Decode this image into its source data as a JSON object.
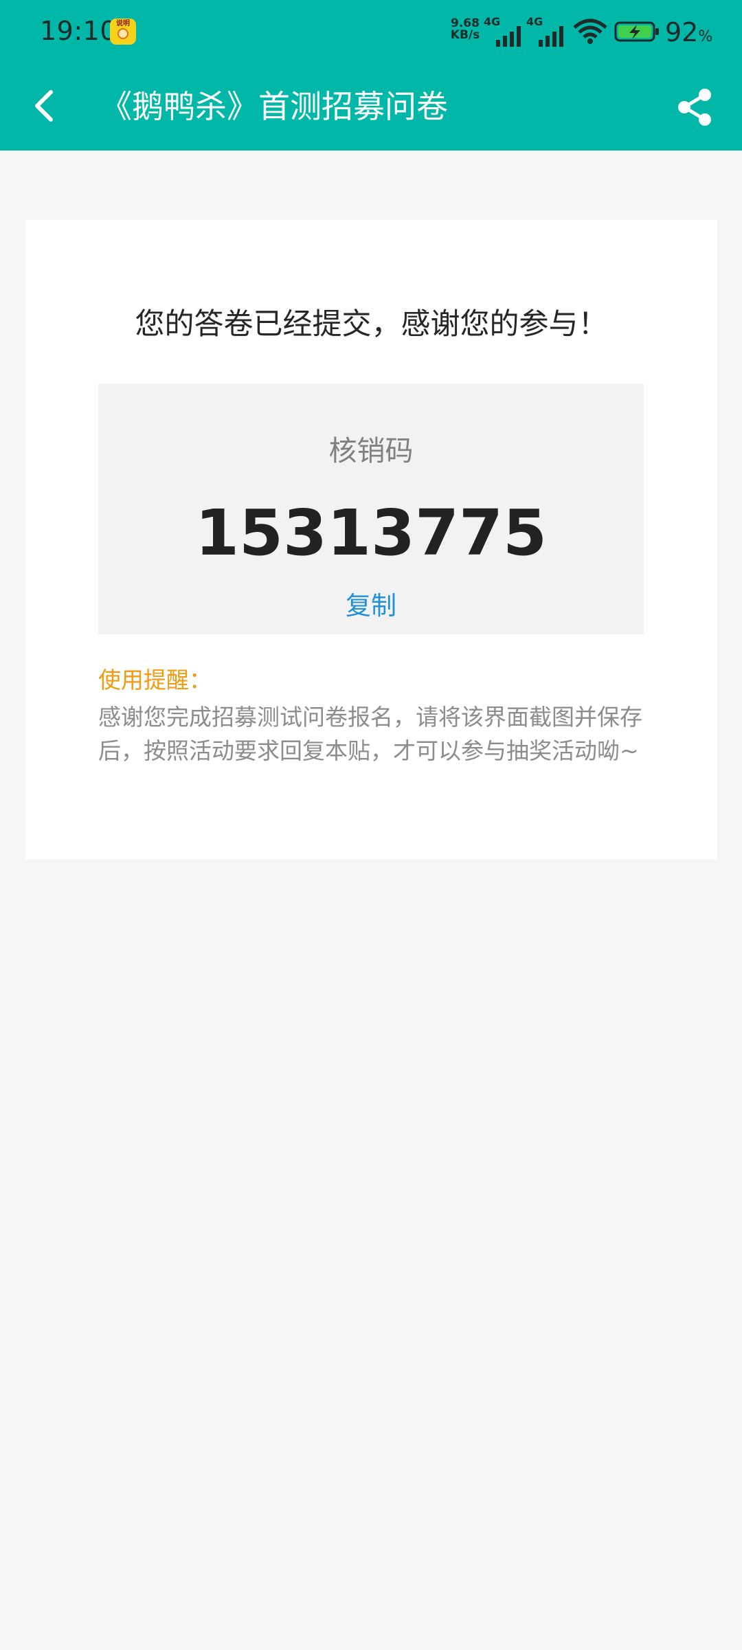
{
  "status_bar": {
    "time": "19:10",
    "app_badge_text": "说明",
    "net_speed_value": "9.68",
    "net_speed_unit": "KB/s",
    "network_type_1": "4G",
    "network_type_2": "4G",
    "battery_level": "92",
    "battery_unit": "%",
    "icons": [
      "signal-icon",
      "wifi-icon",
      "battery-charging-icon"
    ]
  },
  "nav": {
    "title": "《鹅鸭杀》首测招募问卷",
    "back_icon": "chevron-left-icon",
    "share_icon": "share-icon"
  },
  "result": {
    "heading": "您的答卷已经提交，感谢您的参与！",
    "code_label": "核销码",
    "code_value": "15313775",
    "copy_label": "复制",
    "reminder_title": "使用提醒：",
    "reminder_body": "感谢您完成招募测试问卷报名，请将该界面截图并保存后，按照活动要求回复本贴，才可以参与抽奖活动呦~"
  },
  "colors": {
    "header": "#00b7a8",
    "background": "#f6f6f6",
    "card": "#ffffff",
    "code_box": "#f2f2f2",
    "accent_blue": "#1e90d8",
    "reminder_orange": "#f29a12"
  }
}
